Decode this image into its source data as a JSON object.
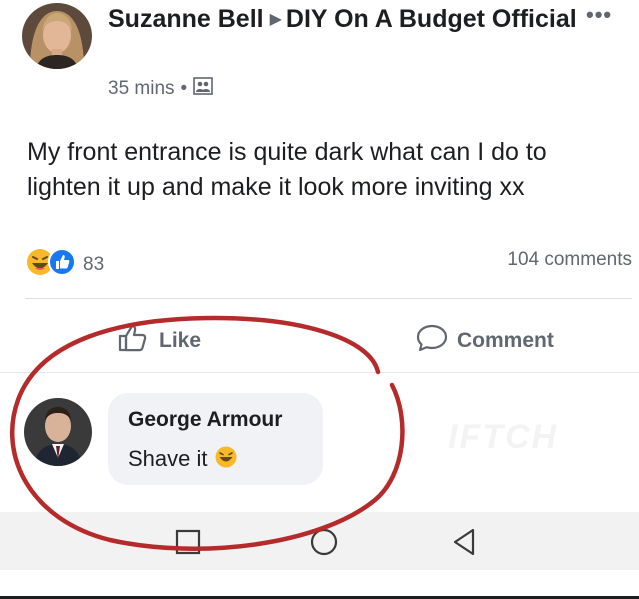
{
  "post": {
    "author": "Suzanne Bell",
    "group": "DIY On A Budget Official",
    "time": "35 mins",
    "text": "My front entrance is quite dark what can I do to lighten it up and make it look more inviting xx",
    "reaction_count": "83",
    "comment_count": "104 comments",
    "reaction_icons": [
      "haha-icon",
      "like-icon"
    ],
    "privacy_icon": "group-icon"
  },
  "actions": {
    "like_label": "Like",
    "comment_label": "Comment"
  },
  "comment": {
    "author": "George Armour",
    "text": "Shave it"
  },
  "watermark": "IFTCH",
  "nav_icons": [
    "recent-apps-icon",
    "home-icon",
    "back-icon"
  ],
  "colors": {
    "annotation_red": "#b52a2a",
    "like_blue": "#1877f2",
    "haha_yellow": "#f7b928",
    "secondary_text": "#606770"
  }
}
